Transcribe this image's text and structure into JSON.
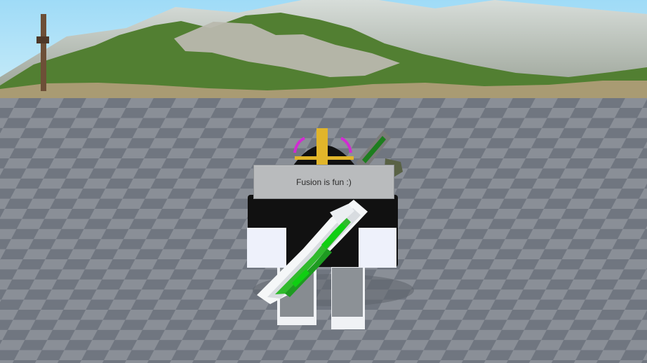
{
  "scene": {
    "chat_bubble_text": "Fusion is fun :)"
  },
  "colors": {
    "sky": "#8fd0f0",
    "mountain": "#c8cec6",
    "greenery": "#3f7c24",
    "baseplate_light": "#8c9199",
    "baseplate_dark": "#6b7078",
    "avatar_body": "#101010",
    "avatar_white": "#e9edf7",
    "helmet_gold": "#e1b52a",
    "helmet_magenta": "#d12bd2",
    "sword_green": "#19b81a"
  },
  "icons": {
    "avatar": "roblox-avatar-icon",
    "sword": "pixel-sword-icon",
    "helmet": "helmet-icon"
  }
}
